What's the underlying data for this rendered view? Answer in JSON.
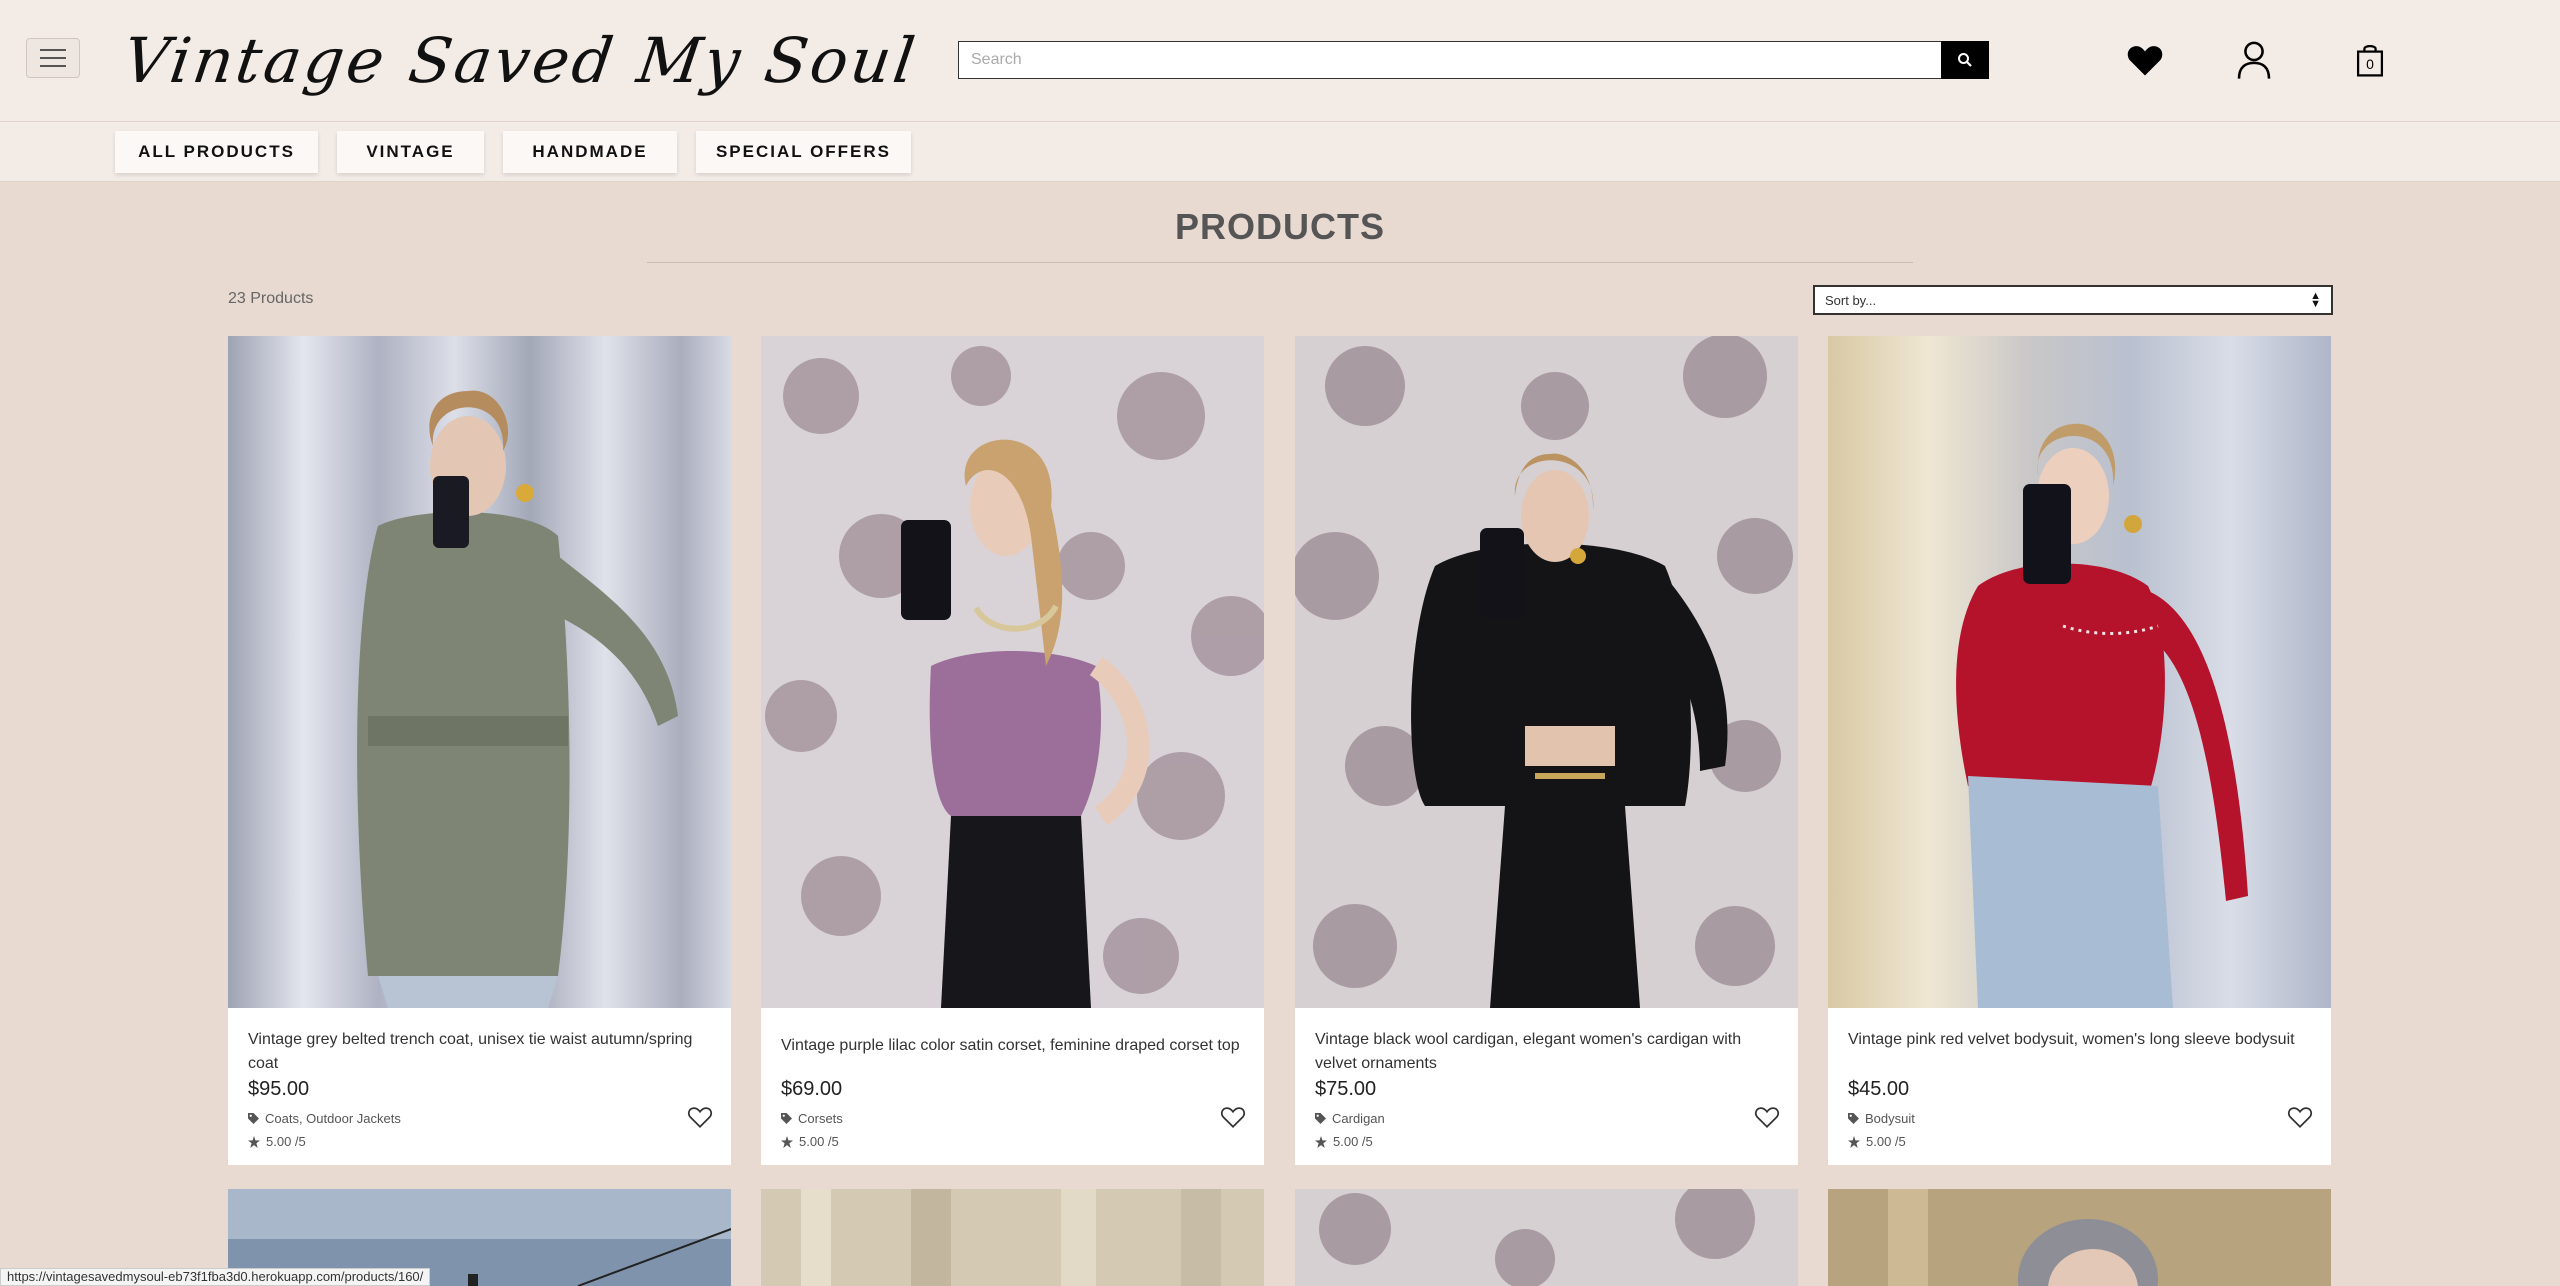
{
  "header": {
    "logo_text": "Vintage Saved My Soul",
    "search_placeholder": "Search",
    "cart_count": "0"
  },
  "categories": [
    "ALL PRODUCTS",
    "VINTAGE",
    "HANDMADE",
    "SPECIAL OFFERS"
  ],
  "main": {
    "title": "PRODUCTS",
    "count_text": "23 Products",
    "sort_placeholder": "Sort by..."
  },
  "products": [
    {
      "name": "Vintage grey belted trench coat, unisex tie waist autumn/spring coat",
      "price": "$95.00",
      "category": "Coats, Outdoor Jackets",
      "rating": "5.00 /5"
    },
    {
      "name": "Vintage purple lilac color satin corset, feminine draped corset top",
      "price": "$69.00",
      "category": "Corsets",
      "rating": "5.00 /5"
    },
    {
      "name": "Vintage black wool cardigan, elegant women's cardigan with velvet ornaments",
      "price": "$75.00",
      "category": "Cardigan",
      "rating": "5.00 /5"
    },
    {
      "name": "Vintage pink red velvet bodysuit, women's long sleeve bodysuit",
      "price": "$45.00",
      "category": "Bodysuit",
      "rating": "5.00 /5"
    }
  ],
  "status_url": "https://vintagesavedmysoul-eb73f1fba3d0.herokuapp.com/products/160/",
  "colors": {
    "page_bg": "#e8d9d1",
    "header_bg": "#f3ebe6",
    "accent": "#000000"
  },
  "icons": {
    "menu": "hamburger-icon",
    "search": "search-icon",
    "wishlist": "heart-icon",
    "account": "user-icon",
    "cart": "bag-icon"
  }
}
